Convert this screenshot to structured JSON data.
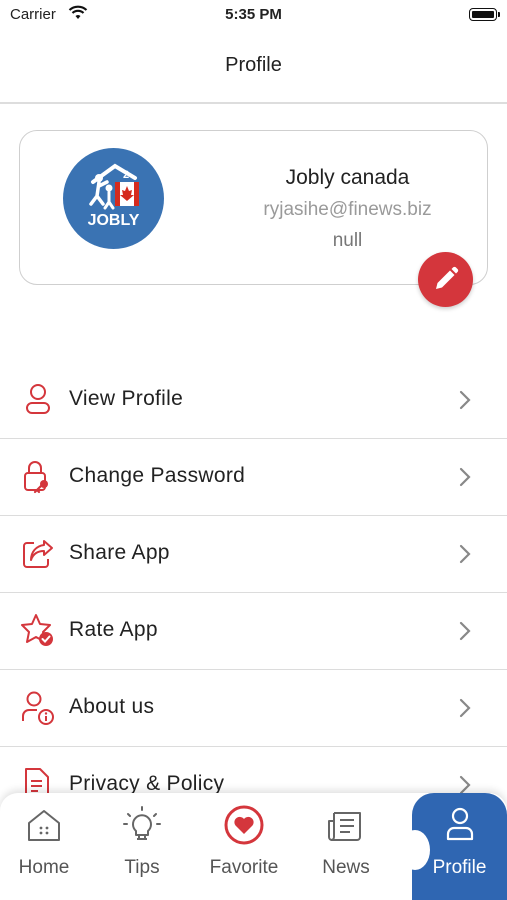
{
  "status_bar": {
    "carrier": "Carrier",
    "time": "5:35 PM"
  },
  "header": {
    "title": "Profile"
  },
  "profile": {
    "logo_text": "JOBLY",
    "name": "Jobly canada",
    "email": "ryjasihe@finews.biz",
    "extra": "null"
  },
  "menu": [
    {
      "label": "View Profile",
      "icon": "user-icon"
    },
    {
      "label": "Change Password",
      "icon": "lock-key-icon"
    },
    {
      "label": "Share App",
      "icon": "share-icon"
    },
    {
      "label": "Rate App",
      "icon": "star-check-icon"
    },
    {
      "label": "About us",
      "icon": "user-info-icon"
    },
    {
      "label": "Privacy & Policy",
      "icon": "document-icon"
    }
  ],
  "tabs": [
    {
      "label": "Home",
      "icon": "home-icon"
    },
    {
      "label": "Tips",
      "icon": "lightbulb-icon"
    },
    {
      "label": "Favorite",
      "icon": "heart-icon"
    },
    {
      "label": "News",
      "icon": "newspaper-icon"
    },
    {
      "label": "Profile",
      "icon": "person-icon",
      "active": true
    }
  ],
  "colors": {
    "accent_red": "#d4363c",
    "accent_blue": "#2f66b2",
    "logo_blue": "#3a73b3"
  }
}
